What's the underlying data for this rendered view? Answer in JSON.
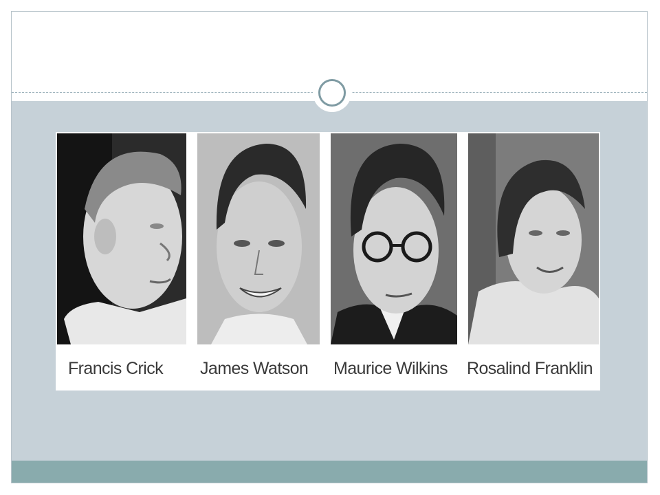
{
  "portraits": [
    {
      "name": "Francis Crick",
      "icon": "portrait-photo-icon"
    },
    {
      "name": "James Watson",
      "icon": "portrait-photo-icon"
    },
    {
      "name": "Maurice Wilkins",
      "icon": "portrait-photo-icon"
    },
    {
      "name": "Rosalind Franklin",
      "icon": "portrait-photo-icon"
    }
  ],
  "colors": {
    "content_band": "#c6d1d8",
    "bottom_band": "#89abad",
    "ornament_ring": "#7f9ba3",
    "caption_text": "#3a3a3a"
  }
}
